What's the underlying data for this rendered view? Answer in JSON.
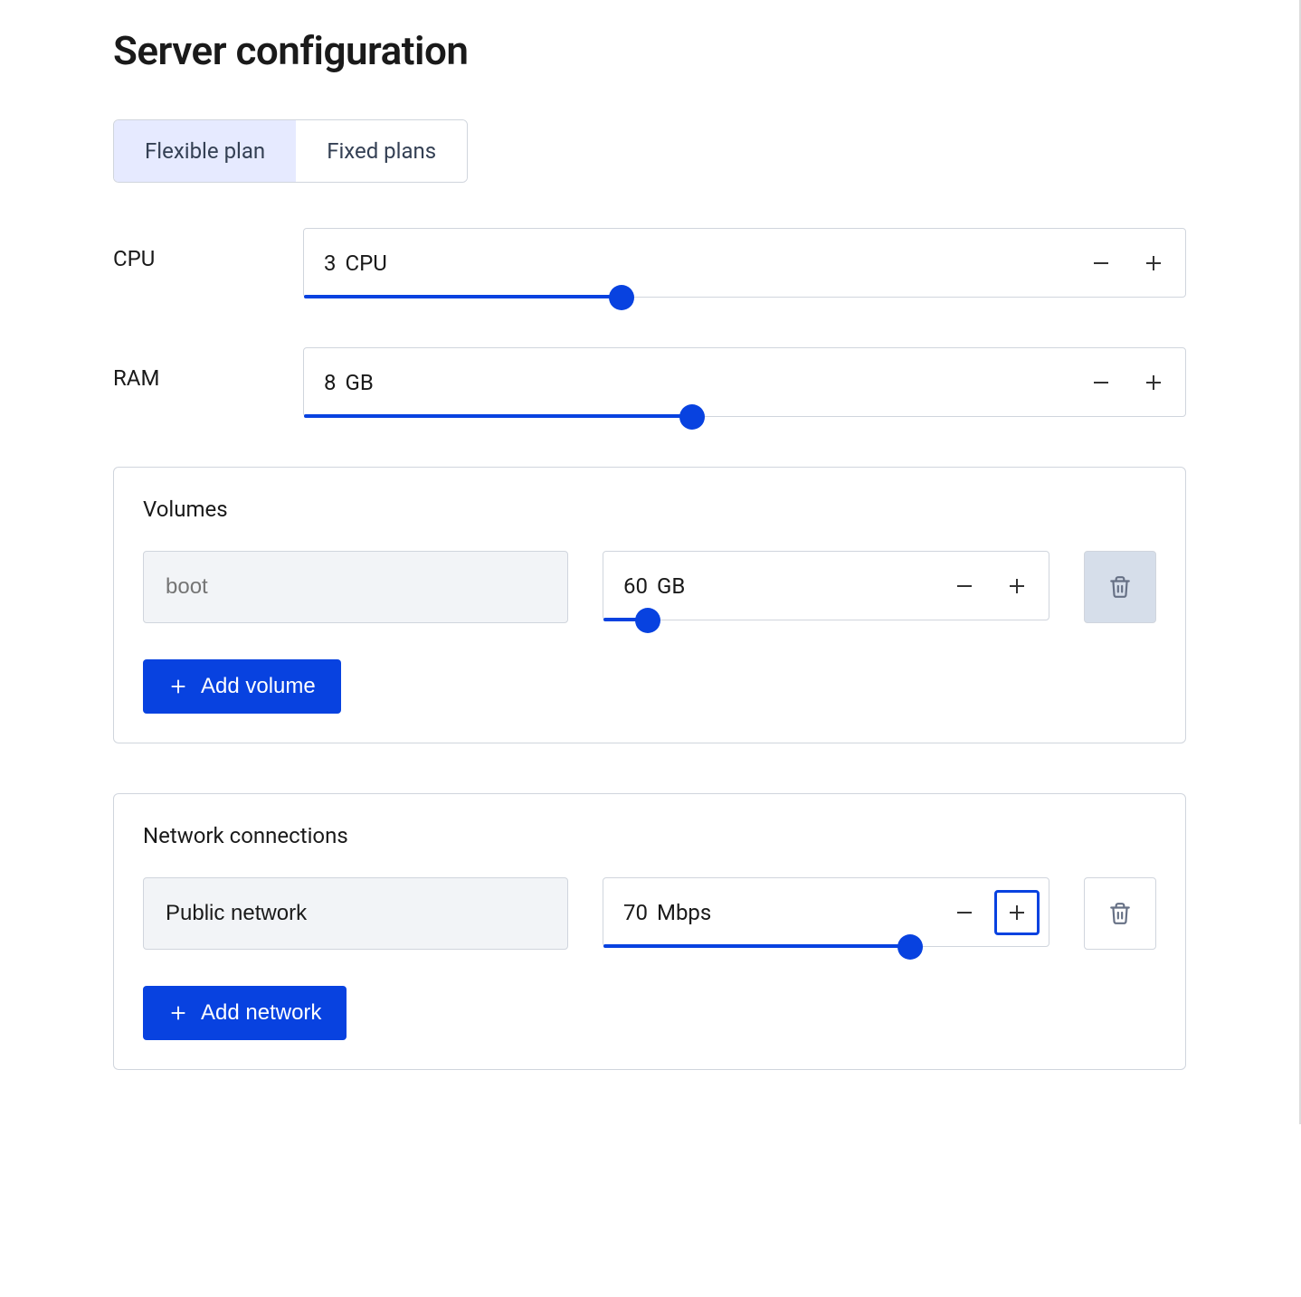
{
  "page_title": "Server configuration",
  "tabs": {
    "flexible": "Flexible plan",
    "fixed": "Fixed plans",
    "active": "flexible"
  },
  "cpu": {
    "label": "CPU",
    "value": "3",
    "unit": "CPU",
    "track_pct": 36
  },
  "ram": {
    "label": "RAM",
    "value": "8",
    "unit": "GB",
    "track_pct": 44
  },
  "volumes": {
    "title": "Volumes",
    "add_label": "Add volume",
    "items": [
      {
        "name": "",
        "placeholder": "boot",
        "value": "60",
        "unit": "GB",
        "track_pct": 10,
        "delete_disabled": true
      }
    ]
  },
  "networks": {
    "title": "Network connections",
    "add_label": "Add network",
    "items": [
      {
        "name": "Public network",
        "placeholder": "",
        "value": "70",
        "unit": "Mbps",
        "track_pct": 69,
        "plus_focused": true,
        "delete_disabled": false
      }
    ]
  }
}
